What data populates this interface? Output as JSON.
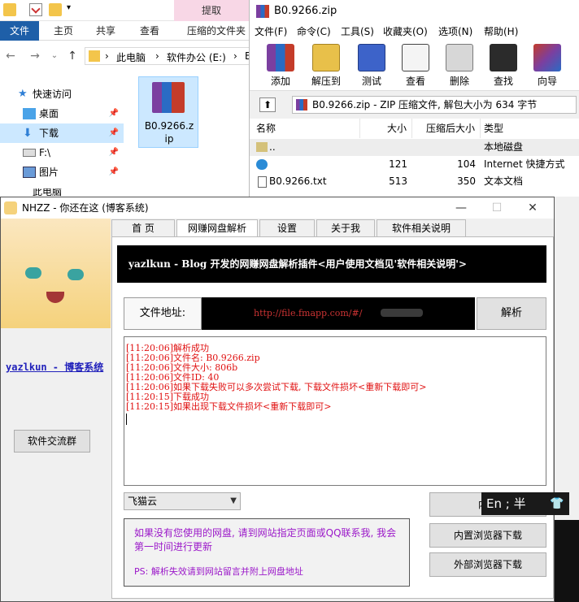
{
  "explorer": {
    "extract_tab": "提取",
    "ribbon_tabs": [
      "文件",
      "主页",
      "共享",
      "查看",
      "压缩的文件夹"
    ],
    "address": [
      "此电脑",
      "软件办公 (E:)",
      "E"
    ],
    "sidebar": [
      {
        "label": "快速访问",
        "icon": "star-icon"
      },
      {
        "label": "桌面",
        "icon": "desktop-icon"
      },
      {
        "label": "下载",
        "icon": "download-icon"
      },
      {
        "label": "F:\\",
        "icon": "drive-icon"
      },
      {
        "label": "图片",
        "icon": "pictures-icon"
      },
      {
        "label": "此电脑",
        "icon": "computer-icon"
      }
    ],
    "file_name": "B0.9266.zip"
  },
  "winrar": {
    "title": "B0.9266.zip",
    "menu": [
      "文件(F)",
      "命令(C)",
      "工具(S)",
      "收藏夹(O)",
      "选项(N)",
      "帮助(H)"
    ],
    "tools": [
      "添加",
      "解压到",
      "测试",
      "查看",
      "删除",
      "查找",
      "向导"
    ],
    "path_info": "B0.9266.zip - ZIP 压缩文件, 解包大小为 634 字节",
    "columns": [
      "名称",
      "大小",
      "压缩后大小",
      "类型"
    ],
    "rows": [
      {
        "name": "..",
        "size": "",
        "packed": "",
        "type": "本地磁盘"
      },
      {
        "name": "",
        "size": "121",
        "packed": "104",
        "type": "Internet 快捷方式"
      },
      {
        "name": "B0.9266.txt",
        "size": "513",
        "packed": "350",
        "type": "文本文档"
      }
    ]
  },
  "nhzz": {
    "title": "NHZZ - 你还在这 (博客系统)",
    "blog_link": "yazlkun - 博客系统",
    "group_button": "软件交流群",
    "tabs": [
      "首 页",
      "网赚网盘解析",
      "设置",
      "关于我",
      "软件相关说明"
    ],
    "banner": "yazlkun - Blog 开发的网赚网盘解析插件<用户使用文档见'软件相关说明'>",
    "address_label": "文件地址:",
    "address_value": "http://file.fmapp.com/#/",
    "parse_button": "解析",
    "log": [
      "[11:20:06]解析成功",
      "[11:20:06]文件名: B0.9266.zip",
      "[11:20:06]文件大小: 806b",
      "[11:20:06]文件ID: 40",
      "[11:20:06]如果下载失败可以多次尝试下载, 下载文件损坏<重新下载即可>",
      "[11:20:15]下载成功",
      "[11:20:15]如果出现下载文件损坏<重新下载即可>"
    ],
    "select_value": "飞猫云",
    "info_text": "如果没有您使用的网盘, 请到网站指定页面或QQ联系我, 我会第一时间进行更新",
    "info_ps": "PS: 解析失效请到网站留言并附上网盘地址",
    "buttons": [
      "内置",
      "内置浏览器下载",
      "外部浏览器下载"
    ]
  },
  "ime": {
    "text": "En ; 半"
  },
  "colors": {
    "log_red": "#e01010",
    "info_purple": "#9b18c9",
    "link_blue": "#2222bb",
    "banner_bg": "#000000"
  }
}
